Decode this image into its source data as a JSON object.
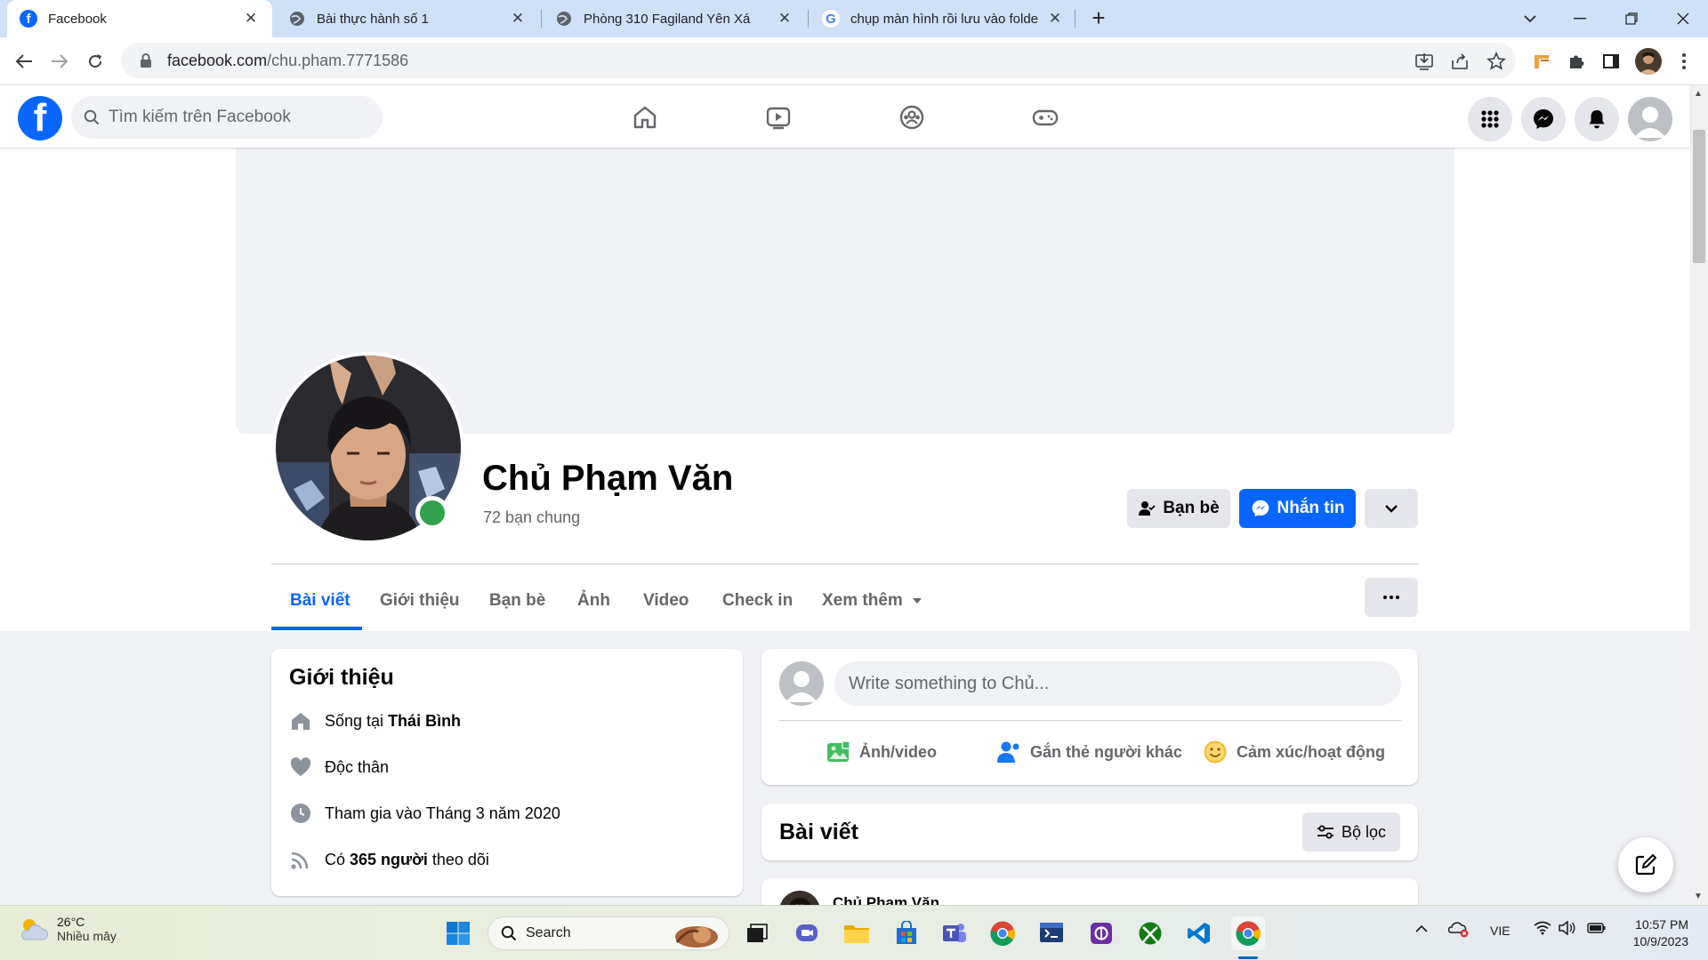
{
  "browser": {
    "tabs": [
      {
        "title": "Facebook",
        "active": true
      },
      {
        "title": "Bài thực hành số 1",
        "active": false
      },
      {
        "title": "Phòng 310 Fagiland Yên Xá",
        "active": false
      },
      {
        "title": "chụp màn hình rồi lưu vào folde",
        "active": false
      }
    ],
    "new_tab": "+",
    "url_host": "facebook.com",
    "url_path": "/chu.pham.7771586"
  },
  "fb_header": {
    "logo": "f",
    "search_placeholder": "Tìm kiếm trên Facebook"
  },
  "profile": {
    "name": "Chủ Phạm Văn",
    "mutual_friends": "72 bạn chung",
    "friends_button": "Bạn bè",
    "message_button": "Nhắn tin"
  },
  "profile_tabs": [
    "Bài viết",
    "Giới thiệu",
    "Bạn bè",
    "Ảnh",
    "Video",
    "Check in",
    "Xem thêm"
  ],
  "intro": {
    "title": "Giới thiệu",
    "lives_prefix": "Sống tại",
    "lives_city": "Thái Bình",
    "relationship": "Độc thân",
    "joined": "Tham gia vào Tháng 3 năm 2020",
    "followers_prefix": "Có",
    "followers_count": "365 người",
    "followers_suffix": "theo dõi"
  },
  "composer": {
    "placeholder": "Write something to Chủ...",
    "photo_video": "Ảnh/video",
    "tag_people": "Gắn thẻ người khác",
    "feeling": "Cảm xúc/hoạt động"
  },
  "posts_header": {
    "title": "Bài viết",
    "filter": "Bộ lọc"
  },
  "first_post": {
    "author": "Chủ Phạm Văn"
  },
  "taskbar": {
    "temperature": "26°C",
    "weather": "Nhiều mây",
    "search": "Search",
    "language": "VIE",
    "time": "10:57 PM",
    "date": "10/9/2023"
  },
  "colors": {
    "fb_blue": "#0866ff",
    "online_green": "#31a24c",
    "chrome_tabbar": "#cfe0f7"
  }
}
